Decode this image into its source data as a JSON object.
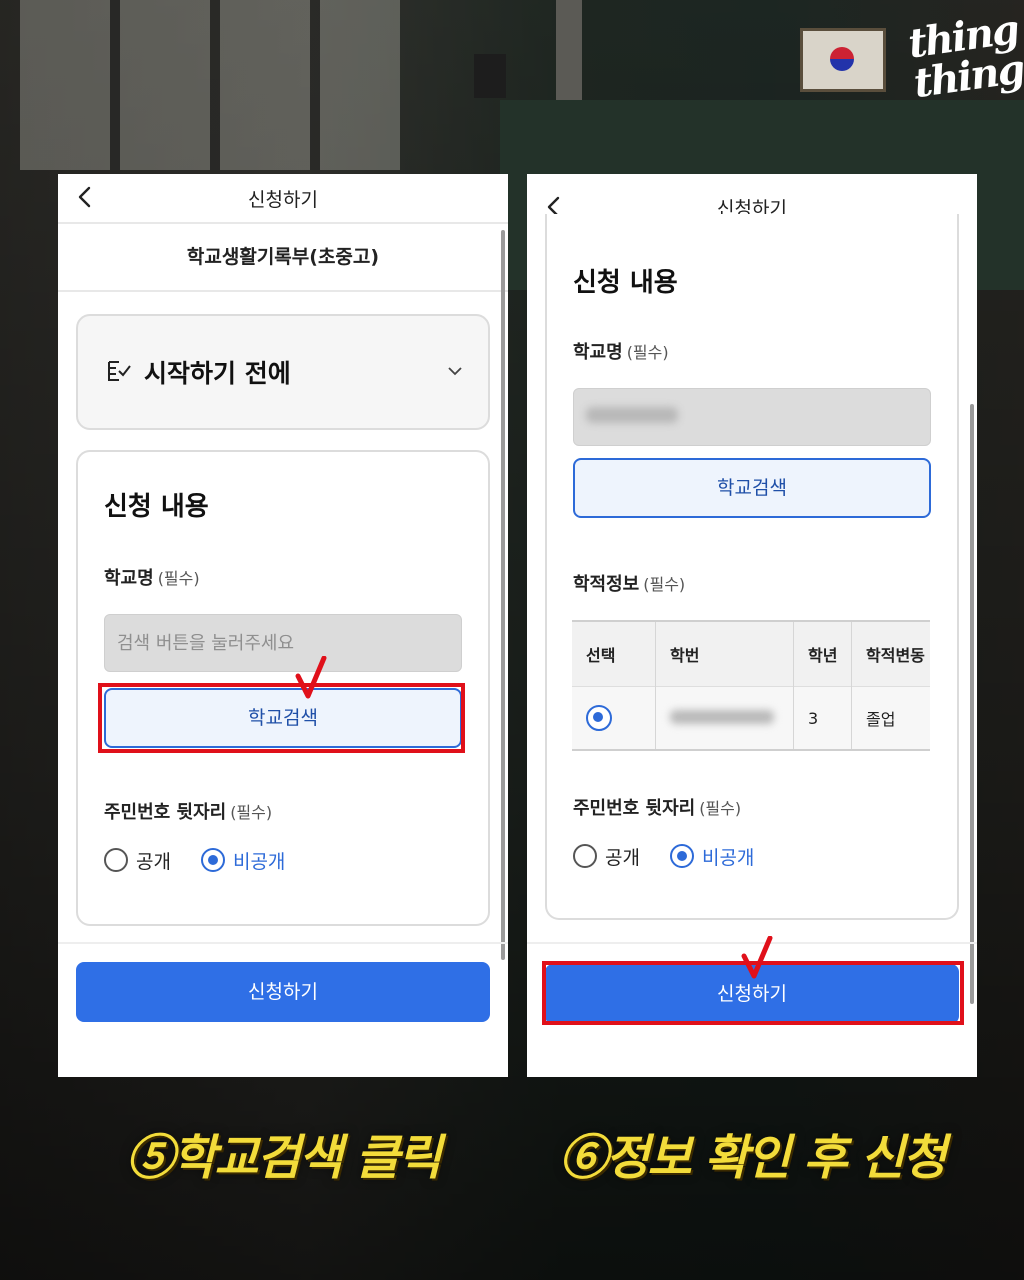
{
  "brand": {
    "logo_line1": "thing",
    "logo_line2": "thing"
  },
  "left_panel": {
    "header_title": "신청하기",
    "sub_title": "학교생활기록부(초중고)",
    "accordion_title": "시작하기 전에",
    "form_title": "신청 내용",
    "school_label": "학교명",
    "required": "(필수)",
    "school_placeholder": "검색 버튼을 눌러주세요",
    "search_button": "학교검색",
    "resident_label": "주민번호 뒷자리",
    "option_public": "공개",
    "option_private": "비공개",
    "submit_button": "신청하기"
  },
  "right_panel": {
    "header_title": "신청하기",
    "form_title": "신청 내용",
    "school_label": "학교명",
    "required": "(필수)",
    "search_button": "학교검색",
    "record_label": "학적정보",
    "table_headers": [
      "선택",
      "학번",
      "학년",
      "학적변동"
    ],
    "table_row": {
      "grade": "3",
      "status": "졸업"
    },
    "resident_label": "주민번호 뒷자리",
    "option_public": "공개",
    "option_private": "비공개",
    "submit_button": "신청하기"
  },
  "captions": {
    "step5": "⑤학교검색 클릭",
    "step6": "⑥정보 확인 후 신청"
  },
  "colors": {
    "accent": "#2f6fe6",
    "highlight": "#e0101a",
    "caption": "#f3dc3a"
  }
}
